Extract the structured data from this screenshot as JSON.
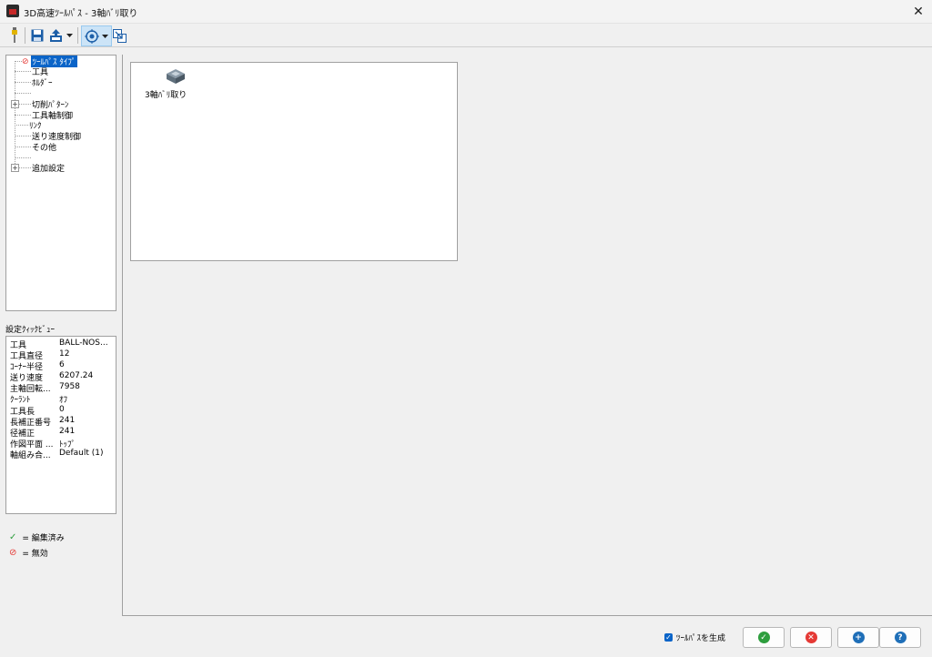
{
  "window": {
    "title": "3D高速ﾂｰﾙﾊﾟｽ - 3軸ﾊﾞﾘ取り",
    "close_glyph": "✕"
  },
  "toolbar": {
    "icons": [
      "tool-icon",
      "save-icon",
      "export-icon",
      "dropdown-icon",
      "coordinate-icon",
      "dropdown-icon",
      "pick-icon"
    ]
  },
  "tree": {
    "items": [
      {
        "label": "ﾂｰﾙﾊﾟｽ ﾀｲﾌﾟ",
        "selected": true,
        "status": "disabled"
      },
      {
        "label": "工具"
      },
      {
        "label": "ﾎﾙﾀﾞｰ"
      },
      {
        "label": ""
      },
      {
        "label": "切削ﾊﾟﾀｰﾝ",
        "expandable": true
      },
      {
        "label": "工具軸制御"
      },
      {
        "label": "ﾘﾝｸ"
      },
      {
        "label": "送り速度制御"
      },
      {
        "label": "その他"
      },
      {
        "label": ""
      },
      {
        "label": "追加設定",
        "expandable": true
      }
    ],
    "expander_glyph": "+"
  },
  "quickview": {
    "title": "設定ｸｨｯｸﾋﾞｭｰ",
    "rows": [
      {
        "key": "工具",
        "value": "BALL-NOS..."
      },
      {
        "key": "工具直径",
        "value": "12"
      },
      {
        "key": "ｺｰﾅｰ半径",
        "value": "6"
      },
      {
        "key": "送り速度",
        "value": "6207.24"
      },
      {
        "key": "主軸回転...",
        "value": "7958"
      },
      {
        "key": "ｸｰﾗﾝﾄ",
        "value": "ｵﾌ"
      },
      {
        "key": "工具長",
        "value": "0"
      },
      {
        "key": "長補正番号",
        "value": "241"
      },
      {
        "key": "径補正",
        "value": "241"
      },
      {
        "key": "作図平面 ...",
        "value": "ﾄｯﾌﾟ"
      },
      {
        "key": "軸組み合...",
        "value": "Default (1)"
      }
    ]
  },
  "legend": {
    "edited": {
      "glyph": "✓",
      "text": "= 編集済み",
      "color": "#2e9e3e"
    },
    "disabled": {
      "glyph": "⊘",
      "text": "= 無効",
      "color": "#e53935"
    }
  },
  "toolpath_types": [
    {
      "label": "3軸ﾊﾞﾘ取り"
    }
  ],
  "footer": {
    "generate_label": "ﾂｰﾙﾊﾟｽを生成",
    "generate_checked": true,
    "buttons": [
      {
        "name": "ok-button",
        "glyph": "✓",
        "color": "#2e9e3e"
      },
      {
        "name": "cancel-button",
        "glyph": "✕",
        "color": "#e53935"
      },
      {
        "name": "apply-button",
        "glyph": "+",
        "color": "#1f6fb8"
      },
      {
        "name": "help-button",
        "glyph": "?",
        "color": "#1f6fb8"
      }
    ]
  }
}
